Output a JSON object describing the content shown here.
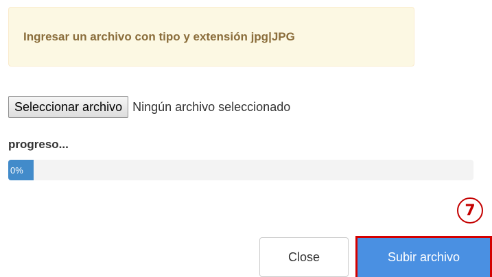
{
  "alert": {
    "message": "Ingresar un archivo con tipo y extensión jpg|JPG"
  },
  "file_input": {
    "button_label": "Seleccionar archivo",
    "status_text": "Ningún archivo seleccionado"
  },
  "progress": {
    "label": "progreso...",
    "value_text": "0%",
    "value": 0
  },
  "annotation": {
    "step_number": "7",
    "color": "#d40000"
  },
  "footer": {
    "close_label": "Close",
    "upload_label": "Subir archivo"
  },
  "colors": {
    "alert_bg": "#fcf8e3",
    "alert_text": "#8a6d3b",
    "progress_fill": "#428bca",
    "primary_button": "#4a90e2"
  }
}
